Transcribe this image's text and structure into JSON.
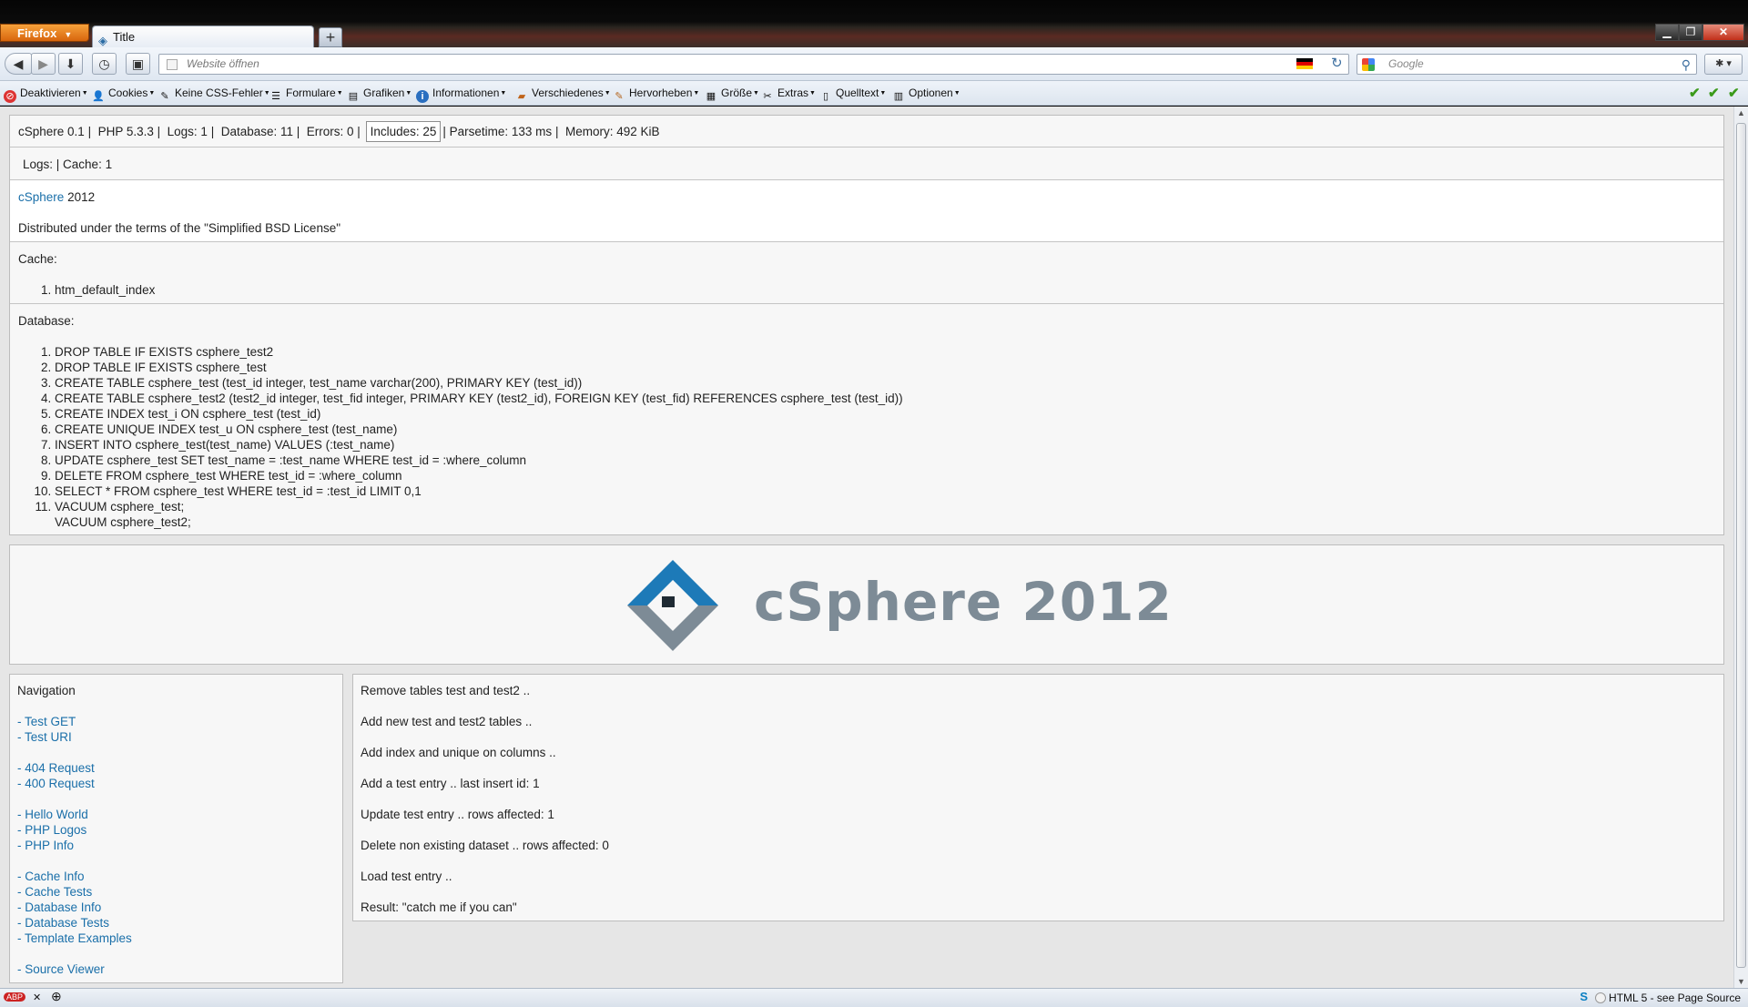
{
  "browser": {
    "menu_label": "Firefox",
    "tab_title": "Title",
    "url_placeholder": "Website öffnen",
    "search_placeholder": "Google",
    "status_text": "HTML 5 - see Page Source"
  },
  "devtoolbar": {
    "items": [
      "Deaktivieren",
      "Cookies",
      "Keine CSS-Fehler",
      "Formulare",
      "Grafiken",
      "Informationen",
      "Verschiedenes",
      "Hervorheben",
      "Größe",
      "Extras",
      "Quelltext",
      "Optionen"
    ]
  },
  "debug": {
    "stats": {
      "version": "cSphere 0.1",
      "php": "PHP 5.3.3",
      "logs": "Logs: 1",
      "database": "Database: 11",
      "errors": "Errors: 0",
      "includes": "Includes: 25",
      "parsetime": "Parsetime: 133 ms",
      "memory": "Memory: 492 KiB"
    },
    "logs_line_logs": "Logs:",
    "logs_line_cache": "Cache: 1",
    "copyright_link": "cSphere",
    "copyright_year": "2012",
    "license": "Distributed under the terms of the \"Simplified BSD License\"",
    "cache_title": "Cache:",
    "cache_items": [
      "htm_default_index"
    ],
    "database_title": "Database:",
    "queries": [
      "DROP TABLE IF EXISTS csphere_test2",
      "DROP TABLE IF EXISTS csphere_test",
      "CREATE TABLE csphere_test (test_id integer, test_name varchar(200), PRIMARY KEY (test_id))",
      "CREATE TABLE csphere_test2 (test2_id integer, test_fid integer, PRIMARY KEY (test2_id), FOREIGN KEY (test_fid) REFERENCES csphere_test (test_id))",
      "CREATE INDEX test_i ON csphere_test (test_id)",
      "CREATE UNIQUE INDEX test_u ON csphere_test (test_name)",
      "INSERT INTO csphere_test(test_name) VALUES (:test_name)",
      "UPDATE csphere_test SET test_name = :test_name WHERE test_id = :where_column",
      "DELETE FROM csphere_test WHERE test_id = :where_column",
      "SELECT * FROM csphere_test WHERE test_id = :test_id LIMIT 0,1",
      "VACUUM csphere_test;"
    ],
    "query_11_continuation": "VACUUM csphere_test2;"
  },
  "banner": {
    "title": "cSphere 2012"
  },
  "navigation": {
    "title": "Navigation",
    "groups": [
      [
        "- Test GET",
        "- Test URI"
      ],
      [
        "- 404 Request",
        "- 400 Request"
      ],
      [
        "- Hello World",
        "- PHP Logos",
        "- PHP Info"
      ],
      [
        "- Cache Info",
        "- Cache Tests",
        "- Database Info",
        "- Database Tests",
        "- Template Examples"
      ],
      [
        "- Source Viewer"
      ]
    ]
  },
  "content": {
    "lines": [
      "Remove tables test and test2 ..",
      "Add new test and test2 tables ..",
      "Add index and unique on columns ..",
      "Add a test entry .. last insert id: 1",
      "Update test entry .. rows affected: 1",
      "Delete non existing dataset .. rows affected: 0",
      "Load test entry ..",
      "Result: \"catch me if you can\""
    ]
  },
  "colors": {
    "link": "#1a6fa9",
    "logo_blue": "#1d7ab8",
    "logo_gray": "#7d8b96",
    "firefox_orange": "#e8801f"
  }
}
